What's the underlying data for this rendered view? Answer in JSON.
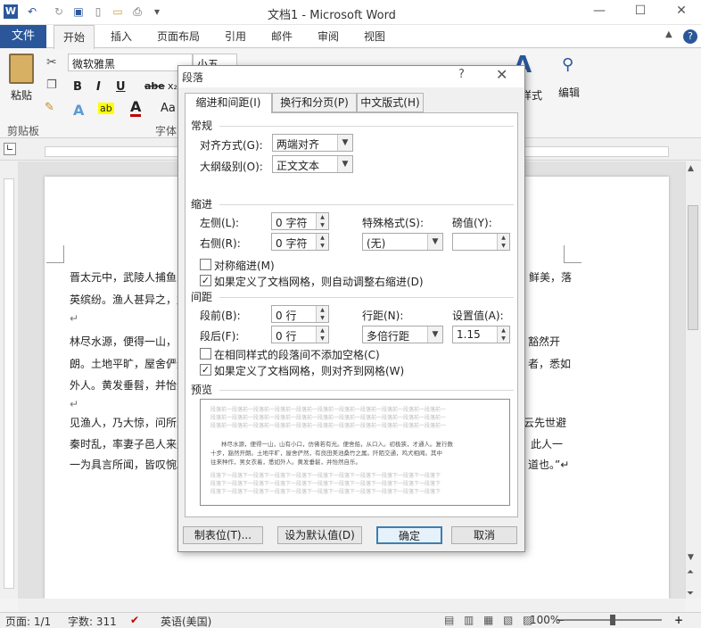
{
  "window": {
    "title": "文档1 - Microsoft Word",
    "app_icon": "W"
  },
  "tabs": {
    "file": "文件",
    "items": [
      "开始",
      "插入",
      "页面布局",
      "引用",
      "邮件",
      "审阅",
      "视图"
    ]
  },
  "ribbon": {
    "font_name": "微软雅黑",
    "font_size": "小五",
    "paste_label": "粘贴",
    "clipboard_group": "剪贴板",
    "font_group": "字体",
    "editing_label": "编辑",
    "styles_label": "样式",
    "format_buttons": [
      "B",
      "I",
      "U",
      "abe",
      "x₂"
    ],
    "font_color_label": "A",
    "aa_label": "Aa"
  },
  "document": {
    "left_lines": [
      "晋太元中，武陵人捕鱼为",
      "英缤纷。渔人甚异之，复",
      "↵",
      "林尽水源，便得一山，山",
      "朗。土地平旷，屋舍俨然",
      "外人。黄发垂髫，并怡然",
      "↵",
      "见渔人，乃大惊，问所从",
      "秦时乱，率妻子邑人来此",
      "一为具言所闻，皆叹惋。"
    ],
    "right_lines": [
      "鲜美，落",
      "",
      "",
      "豁然开",
      "者，悉如",
      "",
      "",
      "云先世避",
      "此人一",
      "道也。”↵"
    ]
  },
  "statusbar": {
    "page": "页面: 1/1",
    "words": "字数: 311",
    "language": "英语(美国)",
    "zoom": "100%"
  },
  "dialog": {
    "title": "段落",
    "help": "?",
    "tabs": [
      "缩进和间距(I)",
      "换行和分页(P)",
      "中文版式(H)"
    ],
    "general": {
      "heading": "常规",
      "alignment_label": "对齐方式(G):",
      "alignment_value": "两端对齐",
      "outline_label": "大纲级别(O):",
      "outline_value": "正文文本"
    },
    "indent": {
      "heading": "缩进",
      "left_label": "左侧(L):",
      "left_value": "0 字符",
      "right_label": "右侧(R):",
      "right_value": "0 字符",
      "special_label": "特殊格式(S):",
      "special_value": "(无)",
      "by_label": "磅值(Y):",
      "by_value": "",
      "mirror_label": "对称缩进(M)",
      "mirror_checked": false,
      "auto_adjust_label": "如果定义了文档网格，则自动调整右缩进(D)",
      "auto_adjust_checked": true
    },
    "spacing": {
      "heading": "间距",
      "before_label": "段前(B):",
      "before_value": "0 行",
      "after_label": "段后(F):",
      "after_value": "0 行",
      "line_label": "行距(N):",
      "line_value": "多倍行距",
      "at_label": "设置值(A):",
      "at_value": "1.15",
      "no_space_label": "在相同样式的段落间不添加空格(C)",
      "no_space_checked": false,
      "snap_label": "如果定义了文档网格，则对齐到网格(W)",
      "snap_checked": true
    },
    "preview": {
      "heading": "预览",
      "gray_text": "段落前一段落前一段落前一段落前一段落前一段落前一段落前一段落前一段落前一段落前一段落前一",
      "sample_lines": [
        "林尽水源，便得一山，山有小口，仿佛若有光。便舍船，从口入。初极狭，才通人。复行数",
        "十步，豁然开朗。土地平旷，屋舍俨然，有良田美池桑竹之属。阡陌交通，鸡犬相闻。其中",
        "往来种作，男女衣着，悉如外人。黄发垂髫，并怡然自乐。"
      ],
      "after_text": "段落下一段落下一段落下一段落下一段落下一段落下一段落下一段落下一段落下一段落下一段落下"
    },
    "buttons": {
      "tabs": "制表位(T)...",
      "default": "设为默认值(D)",
      "ok": "确定",
      "cancel": "取消"
    }
  }
}
